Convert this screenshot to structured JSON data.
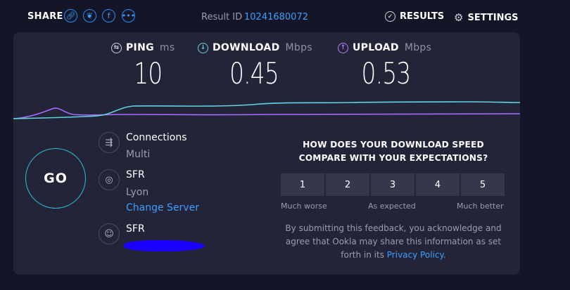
{
  "topbar": {
    "share_label": "SHARE",
    "share_icons": [
      "link-icon",
      "twitter-icon",
      "facebook-icon",
      "more-icon"
    ],
    "result_label": "Result ID",
    "result_id": "10241680072",
    "results_label": "RESULTS",
    "settings_label": "SETTINGS"
  },
  "metrics": {
    "ping": {
      "label": "PING",
      "unit": "ms",
      "value": "10",
      "icon": "ping-icon",
      "color": "#ffffff"
    },
    "download": {
      "label": "DOWNLOAD",
      "unit": "Mbps",
      "value": "0.45",
      "icon": "download-icon",
      "color": "#5fd3e0"
    },
    "upload": {
      "label": "UPLOAD",
      "unit": "Mbps",
      "value": "0.53",
      "icon": "upload-icon",
      "color": "#b57aff"
    }
  },
  "go_label": "GO",
  "info": {
    "connections_title": "Connections",
    "connections_value": "Multi",
    "server_name": "SFR",
    "server_location": "Lyon",
    "change_server": "Change Server",
    "isp_name": "SFR"
  },
  "feedback": {
    "question": "HOW DOES YOUR DOWNLOAD SPEED COMPARE WITH YOUR EXPECTATIONS?",
    "ratings": [
      "1",
      "2",
      "3",
      "4",
      "5"
    ],
    "scale_low": "Much worse",
    "scale_mid": "As expected",
    "scale_high": "Much better",
    "disclaimer_text": "By submitting this feedback, you acknowledge and agree that Ookla may share this information as set forth in its ",
    "privacy_link": "Privacy Policy",
    "disclaimer_end": "."
  },
  "colors": {
    "download_line": "#5fd3e0",
    "upload_line": "#a56bff",
    "accent": "#1e90ff",
    "go_ring": "#29c4d6"
  }
}
